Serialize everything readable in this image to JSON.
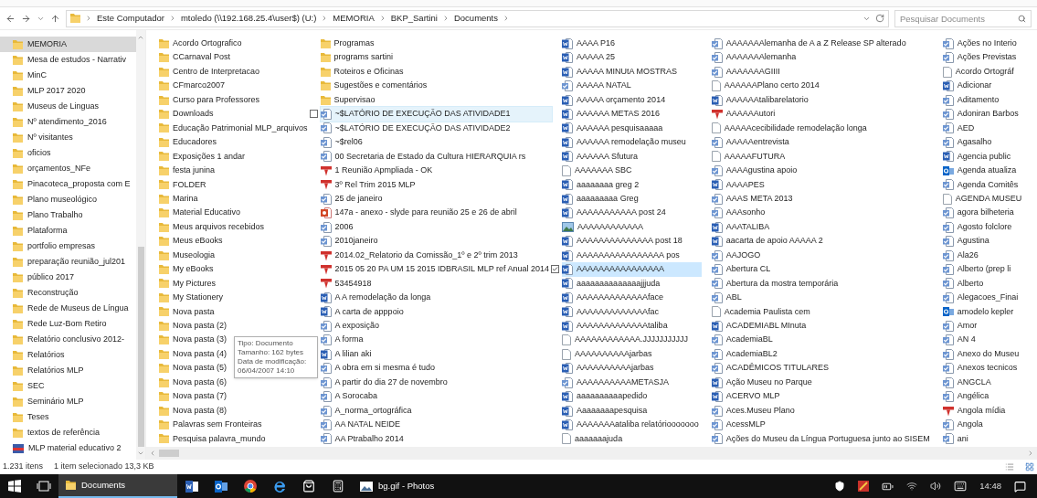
{
  "address_bar": {
    "breadcrumbs": [
      "Este Computador",
      "mtoledo (\\\\192.168.25.4\\user$) (U:)",
      "MEMORIA",
      "BKP_Sartini",
      "Documents"
    ],
    "search": {
      "placeholder": "Pesquisar Documents"
    }
  },
  "sidebar": {
    "items": [
      {
        "name": "MEMORIA",
        "kind": "folder",
        "selected": true
      },
      {
        "name": "Mesa de estudos - Narrativ",
        "kind": "folder",
        "selected": false
      },
      {
        "name": "MinC",
        "kind": "folder",
        "selected": false
      },
      {
        "name": "MLP 2017 2020",
        "kind": "folder",
        "selected": false
      },
      {
        "name": "Museus de Linguas",
        "kind": "folder",
        "selected": false
      },
      {
        "name": "Nº atendimento_2016",
        "kind": "folder",
        "selected": false
      },
      {
        "name": "Nº visitantes",
        "kind": "folder",
        "selected": false
      },
      {
        "name": "oficios",
        "kind": "folder",
        "selected": false
      },
      {
        "name": "orçamentos_NFe",
        "kind": "folder",
        "selected": false
      },
      {
        "name": "Pinacoteca_proposta com E",
        "kind": "folder",
        "selected": false
      },
      {
        "name": "Plano museológico",
        "kind": "folder",
        "selected": false
      },
      {
        "name": "Plano Trabalho",
        "kind": "folder",
        "selected": false
      },
      {
        "name": "Plataforma",
        "kind": "folder",
        "selected": false
      },
      {
        "name": "portfolio empresas",
        "kind": "folder",
        "selected": false
      },
      {
        "name": "preparação reunião_jul201",
        "kind": "folder",
        "selected": false
      },
      {
        "name": "público 2017",
        "kind": "folder",
        "selected": false
      },
      {
        "name": "Reconstrução",
        "kind": "folder",
        "selected": false
      },
      {
        "name": "Rede de Museus de Língua",
        "kind": "folder",
        "selected": false
      },
      {
        "name": "Rede Luz-Bom Retiro",
        "kind": "folder",
        "selected": false
      },
      {
        "name": "Relatório conclusivo 2012-",
        "kind": "folder",
        "selected": false
      },
      {
        "name": "Relatórios",
        "kind": "folder",
        "selected": false
      },
      {
        "name": "Relatórios MLP",
        "kind": "folder",
        "selected": false
      },
      {
        "name": "SEC",
        "kind": "folder",
        "selected": false
      },
      {
        "name": "Seminário MLP",
        "kind": "folder",
        "selected": false
      },
      {
        "name": "Teses",
        "kind": "folder",
        "selected": false
      },
      {
        "name": "textos de referência",
        "kind": "folder",
        "selected": false
      },
      {
        "name": "MLP material educativo 2",
        "kind": "flag",
        "selected": false
      }
    ]
  },
  "files": {
    "columns": [
      [
        {
          "name": "Acordo Ortografico",
          "kind": "folder",
          "selected": false,
          "hovered": false
        },
        {
          "name": "CCarnaval Post",
          "kind": "folder",
          "selected": false,
          "hovered": false
        },
        {
          "name": "Centro de Interpretacao",
          "kind": "folder",
          "selected": false,
          "hovered": false
        },
        {
          "name": "CFmarco2007",
          "kind": "folder",
          "selected": false,
          "hovered": false
        },
        {
          "name": "Curso para Professores",
          "kind": "folder",
          "selected": false,
          "hovered": false
        },
        {
          "name": "Downloads",
          "kind": "folder",
          "selected": false,
          "hovered": false
        },
        {
          "name": "Educação Patrimonial MLP_arquivos",
          "kind": "folder",
          "selected": false,
          "hovered": false
        },
        {
          "name": "Educadores",
          "kind": "folder",
          "selected": false,
          "hovered": false
        },
        {
          "name": "Exposições 1 andar",
          "kind": "folder",
          "selected": false,
          "hovered": false
        },
        {
          "name": "festa junina",
          "kind": "folder",
          "selected": false,
          "hovered": false
        },
        {
          "name": "FOLDER",
          "kind": "folder",
          "selected": false,
          "hovered": false
        },
        {
          "name": "Marina",
          "kind": "folder",
          "selected": false,
          "hovered": false
        },
        {
          "name": "Material Educativo",
          "kind": "folder",
          "selected": false,
          "hovered": false
        },
        {
          "name": "Meus arquivos recebidos",
          "kind": "folder",
          "selected": false,
          "hovered": false
        },
        {
          "name": "Meus eBooks",
          "kind": "folder",
          "selected": false,
          "hovered": false
        },
        {
          "name": "Museologia",
          "kind": "folder",
          "selected": false,
          "hovered": false
        },
        {
          "name": "My eBooks",
          "kind": "folder",
          "selected": false,
          "hovered": false
        },
        {
          "name": "My Pictures",
          "kind": "folder",
          "selected": false,
          "hovered": false
        },
        {
          "name": "My Stationery",
          "kind": "folder",
          "selected": false,
          "hovered": false
        },
        {
          "name": "Nova pasta",
          "kind": "folder",
          "selected": false,
          "hovered": false
        },
        {
          "name": "Nova pasta (2)",
          "kind": "folder",
          "selected": false,
          "hovered": false
        },
        {
          "name": "Nova pasta (3)",
          "kind": "folder",
          "selected": false,
          "hovered": false
        },
        {
          "name": "Nova pasta (4)",
          "kind": "folder",
          "selected": false,
          "hovered": false
        },
        {
          "name": "Nova pasta (5)",
          "kind": "folder",
          "selected": false,
          "hovered": false
        },
        {
          "name": "Nova pasta (6)",
          "kind": "folder",
          "selected": false,
          "hovered": false
        },
        {
          "name": "Nova pasta (7)",
          "kind": "folder",
          "selected": false,
          "hovered": false
        },
        {
          "name": "Nova pasta (8)",
          "kind": "folder",
          "selected": false,
          "hovered": false
        },
        {
          "name": "Palavras sem Fronteiras",
          "kind": "folder",
          "selected": false,
          "hovered": false
        },
        {
          "name": "Pesquisa palavra_mundo",
          "kind": "folder",
          "selected": false,
          "hovered": false
        }
      ],
      [
        {
          "name": "Programas",
          "kind": "folder",
          "selected": false,
          "hovered": false
        },
        {
          "name": "programs sartini",
          "kind": "folder",
          "selected": false,
          "hovered": false
        },
        {
          "name": "Roteiros e Oficinas",
          "kind": "folder",
          "selected": false,
          "hovered": false
        },
        {
          "name": "Sugestões e comentários",
          "kind": "folder",
          "selected": false,
          "hovered": false
        },
        {
          "name": "Supervisao",
          "kind": "folder",
          "selected": false,
          "hovered": false
        },
        {
          "name": "~$LATÓRIO DE EXECUÇÃO DAS ATIVIDADE1",
          "kind": "doc",
          "selected": false,
          "hovered": true
        },
        {
          "name": "~$LATÓRIO DE EXECUÇÃO DAS ATIVIDADE2",
          "kind": "doc",
          "selected": false,
          "hovered": false
        },
        {
          "name": "~$rel06",
          "kind": "doc",
          "selected": false,
          "hovered": false
        },
        {
          "name": "00 Secretaria de Estado da Cultura HIERARQUIA rs",
          "kind": "doc",
          "selected": false,
          "hovered": false
        },
        {
          "name": "1 Reunião Apmpliada - OK",
          "kind": "pdf",
          "selected": false,
          "hovered": false
        },
        {
          "name": "3º Rel Trim 2015 MLP",
          "kind": "pdf",
          "selected": false,
          "hovered": false
        },
        {
          "name": "25 de janeiro",
          "kind": "doc",
          "selected": false,
          "hovered": false
        },
        {
          "name": "147a - anexo - slyde para reunião 25 e 26 de abril",
          "kind": "slides",
          "selected": false,
          "hovered": false
        },
        {
          "name": "2006",
          "kind": "doc",
          "selected": false,
          "hovered": false
        },
        {
          "name": "2010janeiro",
          "kind": "doc",
          "selected": false,
          "hovered": false
        },
        {
          "name": "2014.02_Relatorio da Comissão_1º e 2º trim 2013",
          "kind": "pdf",
          "selected": false,
          "hovered": false
        },
        {
          "name": "2015 05 20 PA UM 15 2015 IDBRASIL MLP ref Anual 2014",
          "kind": "pdf",
          "selected": false,
          "hovered": false
        },
        {
          "name": "53454918",
          "kind": "pdf",
          "selected": false,
          "hovered": false
        },
        {
          "name": "A A remodelação da longa",
          "kind": "word",
          "selected": false,
          "hovered": false
        },
        {
          "name": "A carta de apppoio",
          "kind": "word",
          "selected": false,
          "hovered": false
        },
        {
          "name": "A exposição",
          "kind": "doc",
          "selected": false,
          "hovered": false
        },
        {
          "name": "A forma",
          "kind": "doc",
          "selected": false,
          "hovered": false
        },
        {
          "name": "A lilian aki",
          "kind": "word",
          "selected": false,
          "hovered": false
        },
        {
          "name": "A obra em si mesma é tudo",
          "kind": "doc",
          "selected": false,
          "hovered": false
        },
        {
          "name": "A partir do dia 27 de novembro",
          "kind": "doc",
          "selected": false,
          "hovered": false
        },
        {
          "name": "A Sorocaba",
          "kind": "doc",
          "selected": false,
          "hovered": false
        },
        {
          "name": "A_norma_ortográfica",
          "kind": "doc",
          "selected": false,
          "hovered": false
        },
        {
          "name": "AA NATAL NEIDE",
          "kind": "doc",
          "selected": false,
          "hovered": false
        },
        {
          "name": "AA Ptrabalho 2014",
          "kind": "doc",
          "selected": false,
          "hovered": false
        }
      ],
      [
        {
          "name": "AAAA P16",
          "kind": "word",
          "selected": false,
          "hovered": false
        },
        {
          "name": "AAAAA 25",
          "kind": "word",
          "selected": false,
          "hovered": false
        },
        {
          "name": "AAAAA MINUtA MOSTRAS",
          "kind": "word",
          "selected": false,
          "hovered": false
        },
        {
          "name": "AAAAA NATAL",
          "kind": "doc",
          "selected": false,
          "hovered": false
        },
        {
          "name": "AAAAA orçamento 2014",
          "kind": "word",
          "selected": false,
          "hovered": false
        },
        {
          "name": "AAAAAA METAS 2016",
          "kind": "word",
          "selected": false,
          "hovered": false
        },
        {
          "name": "AAAAAA pesquisaaaaa",
          "kind": "word",
          "selected": false,
          "hovered": false
        },
        {
          "name": "AAAAAA remodelação museu",
          "kind": "word",
          "selected": false,
          "hovered": false
        },
        {
          "name": "AAAAAA Sfutura",
          "kind": "word",
          "selected": false,
          "hovered": false
        },
        {
          "name": "AAAAAAA SBC",
          "kind": "blank",
          "selected": false,
          "hovered": false
        },
        {
          "name": "aaaaaaaa greg 2",
          "kind": "word",
          "selected": false,
          "hovered": false
        },
        {
          "name": "aaaaaaaaa Greg",
          "kind": "word",
          "selected": false,
          "hovered": false
        },
        {
          "name": "AAAAAAAAAAA post 24",
          "kind": "word",
          "selected": false,
          "hovered": false
        },
        {
          "name": "AAAAAAAAAAAA",
          "kind": "image",
          "selected": false,
          "hovered": false
        },
        {
          "name": "AAAAAAAAAAAAAA post 18",
          "kind": "word",
          "selected": false,
          "hovered": false
        },
        {
          "name": "AAAAAAAAAAAAAAAA pos",
          "kind": "word",
          "selected": false,
          "hovered": false
        },
        {
          "name": "AAAAAAAAAAAAAAAA",
          "kind": "word",
          "selected": true,
          "hovered": false
        },
        {
          "name": "aaaaaaaaaaaaaajjjuda",
          "kind": "word",
          "selected": false,
          "hovered": false
        },
        {
          "name": "AAAAAAAAAAAAAface",
          "kind": "word",
          "selected": false,
          "hovered": false
        },
        {
          "name": "AAAAAAAAAAAAAfac",
          "kind": "word",
          "selected": false,
          "hovered": false
        },
        {
          "name": "AAAAAAAAAAAAAtaliba",
          "kind": "word",
          "selected": false,
          "hovered": false
        },
        {
          "name": "AAAAAAAAAAAA.JJJJJJJJJJJ",
          "kind": "blank",
          "selected": false,
          "hovered": false
        },
        {
          "name": "AAAAAAAAAAjarbas",
          "kind": "blank",
          "selected": false,
          "hovered": false
        },
        {
          "name": "AAAAAAAAAAjarbas",
          "kind": "word",
          "selected": false,
          "hovered": false
        },
        {
          "name": "AAAAAAAAAAMETASJA",
          "kind": "doc",
          "selected": false,
          "hovered": false
        },
        {
          "name": "aaaaaaaaaapedido",
          "kind": "word",
          "selected": false,
          "hovered": false
        },
        {
          "name": "Aaaaaaaapesquisa",
          "kind": "word",
          "selected": false,
          "hovered": false
        },
        {
          "name": "AAAAAAAataliba relatóriooooooo",
          "kind": "word",
          "selected": false,
          "hovered": false
        },
        {
          "name": "aaaaaaajuda",
          "kind": "blank",
          "selected": false,
          "hovered": false
        }
      ],
      [
        {
          "name": "AAAAAAAlemanha de A a Z Release SP alterado",
          "kind": "doc",
          "selected": false,
          "hovered": false
        },
        {
          "name": "AAAAAAAlemanha",
          "kind": "doc",
          "selected": false,
          "hovered": false
        },
        {
          "name": "AAAAAAAGIIII",
          "kind": "doc",
          "selected": false,
          "hovered": false
        },
        {
          "name": "AAAAAAPlano certo 2014",
          "kind": "blank",
          "selected": false,
          "hovered": false
        },
        {
          "name": "AAAAAAtalibarelatorio",
          "kind": "word",
          "selected": false,
          "hovered": false
        },
        {
          "name": "AAAAAAutori",
          "kind": "pdf",
          "selected": false,
          "hovered": false
        },
        {
          "name": "AAAAAcecibilidade remodelação longa",
          "kind": "blank",
          "selected": false,
          "hovered": false
        },
        {
          "name": "AAAAAentrevista",
          "kind": "doc",
          "selected": false,
          "hovered": false
        },
        {
          "name": "AAAAAFUTURA",
          "kind": "blank",
          "selected": false,
          "hovered": false
        },
        {
          "name": "AAAAgustina apoio",
          "kind": "doc",
          "selected": false,
          "hovered": false
        },
        {
          "name": "AAAAPES",
          "kind": "word",
          "selected": false,
          "hovered": false
        },
        {
          "name": "AAAS META 2013",
          "kind": "doc",
          "selected": false,
          "hovered": false
        },
        {
          "name": "AAAsonho",
          "kind": "doc",
          "selected": false,
          "hovered": false
        },
        {
          "name": "AAATALIBA",
          "kind": "word",
          "selected": false,
          "hovered": false
        },
        {
          "name": "aacarta de apoio AAAAA 2",
          "kind": "word",
          "selected": false,
          "hovered": false
        },
        {
          "name": "AAJOGO",
          "kind": "doc",
          "selected": false,
          "hovered": false
        },
        {
          "name": "Abertura CL",
          "kind": "doc",
          "selected": false,
          "hovered": false
        },
        {
          "name": "Abertura da mostra temporária",
          "kind": "doc",
          "selected": false,
          "hovered": false
        },
        {
          "name": "ABL",
          "kind": "doc",
          "selected": false,
          "hovered": false
        },
        {
          "name": "Academia Paulista cem",
          "kind": "blank",
          "selected": false,
          "hovered": false
        },
        {
          "name": "ACADEMIABL MInuta",
          "kind": "word",
          "selected": false,
          "hovered": false
        },
        {
          "name": "AcademiaBL",
          "kind": "doc",
          "selected": false,
          "hovered": false
        },
        {
          "name": "AcademiaBL2",
          "kind": "doc",
          "selected": false,
          "hovered": false
        },
        {
          "name": "ACADÊMICOS TITULARES",
          "kind": "doc",
          "selected": false,
          "hovered": false
        },
        {
          "name": "Ação Museu no Parque",
          "kind": "word",
          "selected": false,
          "hovered": false
        },
        {
          "name": "ACERVO MLP",
          "kind": "word",
          "selected": false,
          "hovered": false
        },
        {
          "name": "Aces.Museu Plano",
          "kind": "doc",
          "selected": false,
          "hovered": false
        },
        {
          "name": "AcessMLP",
          "kind": "doc",
          "selected": false,
          "hovered": false
        },
        {
          "name": "Ações do Museu da Língua Portuguesa junto ao SISEM",
          "kind": "doc",
          "selected": false,
          "hovered": false
        }
      ],
      [
        {
          "name": "Ações no Interio",
          "kind": "doc",
          "selected": false,
          "hovered": false
        },
        {
          "name": "Ações Previstas",
          "kind": "doc",
          "selected": false,
          "hovered": false
        },
        {
          "name": "Acordo Ortográf",
          "kind": "blank",
          "selected": false,
          "hovered": false
        },
        {
          "name": "Adicionar",
          "kind": "word",
          "selected": false,
          "hovered": false
        },
        {
          "name": "Aditamento",
          "kind": "doc",
          "selected": false,
          "hovered": false
        },
        {
          "name": "Adoniran Barbos",
          "kind": "doc",
          "selected": false,
          "hovered": false
        },
        {
          "name": "AED",
          "kind": "doc",
          "selected": false,
          "hovered": false
        },
        {
          "name": "Agasalho",
          "kind": "doc",
          "selected": false,
          "hovered": false
        },
        {
          "name": "Agencia public",
          "kind": "word",
          "selected": false,
          "hovered": false
        },
        {
          "name": "Agenda atualiza",
          "kind": "mail",
          "selected": false,
          "hovered": false
        },
        {
          "name": "Agenda Comitês",
          "kind": "doc",
          "selected": false,
          "hovered": false
        },
        {
          "name": "AGENDA MUSEU",
          "kind": "blank",
          "selected": false,
          "hovered": false
        },
        {
          "name": "agora bilheteria",
          "kind": "doc",
          "selected": false,
          "hovered": false
        },
        {
          "name": "Agosto folclore",
          "kind": "doc",
          "selected": false,
          "hovered": false
        },
        {
          "name": "Agustina",
          "kind": "doc",
          "selected": false,
          "hovered": false
        },
        {
          "name": "Ala26",
          "kind": "doc",
          "selected": false,
          "hovered": false
        },
        {
          "name": "Alberto (prep li",
          "kind": "doc",
          "selected": false,
          "hovered": false
        },
        {
          "name": "Alberto",
          "kind": "doc",
          "selected": false,
          "hovered": false
        },
        {
          "name": "Alegacoes_Finai",
          "kind": "doc",
          "selected": false,
          "hovered": false
        },
        {
          "name": "amodelo kepler",
          "kind": "mail",
          "selected": false,
          "hovered": false
        },
        {
          "name": "Amor",
          "kind": "doc",
          "selected": false,
          "hovered": false
        },
        {
          "name": "AN 4",
          "kind": "doc",
          "selected": false,
          "hovered": false
        },
        {
          "name": "Anexo do Museu",
          "kind": "doc",
          "selected": false,
          "hovered": false
        },
        {
          "name": "Anexos tecnicos",
          "kind": "doc",
          "selected": false,
          "hovered": false
        },
        {
          "name": "ANGCLA",
          "kind": "doc",
          "selected": false,
          "hovered": false
        },
        {
          "name": "Angélica",
          "kind": "doc",
          "selected": false,
          "hovered": false
        },
        {
          "name": "Angola mídia",
          "kind": "pdf",
          "selected": false,
          "hovered": false
        },
        {
          "name": "Angola",
          "kind": "doc",
          "selected": false,
          "hovered": false
        },
        {
          "name": "ani",
          "kind": "doc",
          "selected": false,
          "hovered": false
        }
      ]
    ]
  },
  "tooltip": {
    "lines": [
      "Tipo: Documento",
      "Tamanho: 162 bytes",
      "Data de modificação: 06/04/2007 14:10"
    ]
  },
  "status_bar": {
    "item_count": "1.231 itens",
    "selection": "1 item selecionado 13,3 KB"
  },
  "taskbar": {
    "apps": [
      {
        "kind": "start",
        "active": false
      },
      {
        "kind": "task_view",
        "active": false
      },
      {
        "kind": "folder",
        "label": "Documents",
        "active": true
      },
      {
        "kind": "word",
        "active": false
      },
      {
        "kind": "mail",
        "active": false
      },
      {
        "kind": "browser",
        "active": false
      },
      {
        "kind": "edge",
        "active": false
      },
      {
        "kind": "store",
        "active": false
      },
      {
        "kind": "calculator",
        "active": false
      },
      {
        "kind": "photos",
        "label": "bg.gif - Photos",
        "active": false
      }
    ],
    "clock": "14:48"
  }
}
